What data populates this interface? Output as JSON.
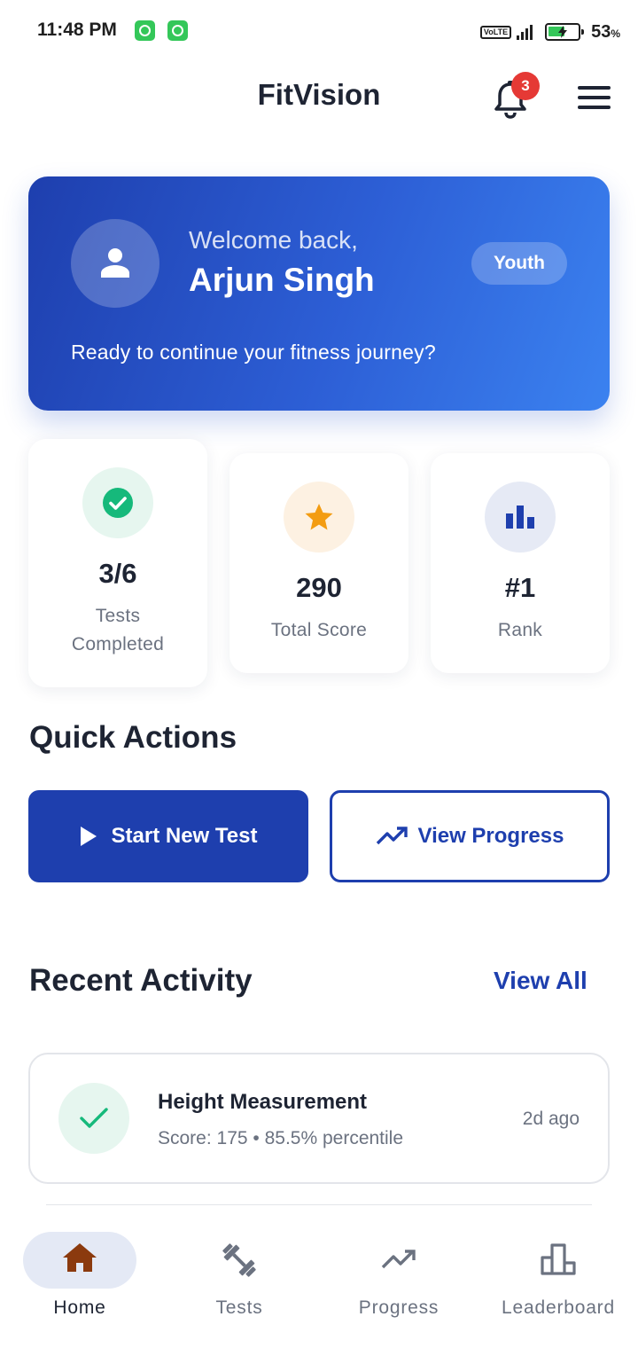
{
  "status_bar": {
    "time": "11:48 PM",
    "network": "VoLTE",
    "battery_percent": "53",
    "battery_unit": "%"
  },
  "header": {
    "title": "FitVision",
    "notification_count": "3"
  },
  "welcome": {
    "greeting": "Welcome back,",
    "name": "Arjun Singh",
    "badge": "Youth",
    "subtitle": "Ready to continue your fitness journey?"
  },
  "stats": [
    {
      "value": "3/6",
      "label": "Tests Completed",
      "icon": "check-circle-icon",
      "color": "#16b97b",
      "bg": "#e6f6ef"
    },
    {
      "value": "290",
      "label": "Total Score",
      "icon": "star-icon",
      "color": "#f39c12",
      "bg": "#fdf1e2"
    },
    {
      "value": "#1",
      "label": "Rank",
      "icon": "bar-chart-icon",
      "color": "#1e3fae",
      "bg": "#e6eaf5"
    }
  ],
  "quick_actions": {
    "title": "Quick Actions",
    "start_test": "Start New Test",
    "view_progress": "View Progress"
  },
  "recent_activity": {
    "title": "Recent Activity",
    "view_all": "View All",
    "items": [
      {
        "title": "Height Measurement",
        "meta": "Score: 175 • 85.5% percentile",
        "time": "2d ago"
      }
    ]
  },
  "bottom_nav": {
    "items": [
      {
        "label": "Home",
        "icon": "home-icon",
        "active": true
      },
      {
        "label": "Tests",
        "icon": "dumbbell-icon",
        "active": false
      },
      {
        "label": "Progress",
        "icon": "trending-up-icon",
        "active": false
      },
      {
        "label": "Leaderboard",
        "icon": "leaderboard-icon",
        "active": false
      }
    ]
  },
  "colors": {
    "primary": "#1e3fae",
    "accent_blue": "#3b82f0",
    "success": "#16b97b",
    "star": "#f39c12",
    "home_active": "#8b3a0e",
    "badge_red": "#e53935"
  }
}
